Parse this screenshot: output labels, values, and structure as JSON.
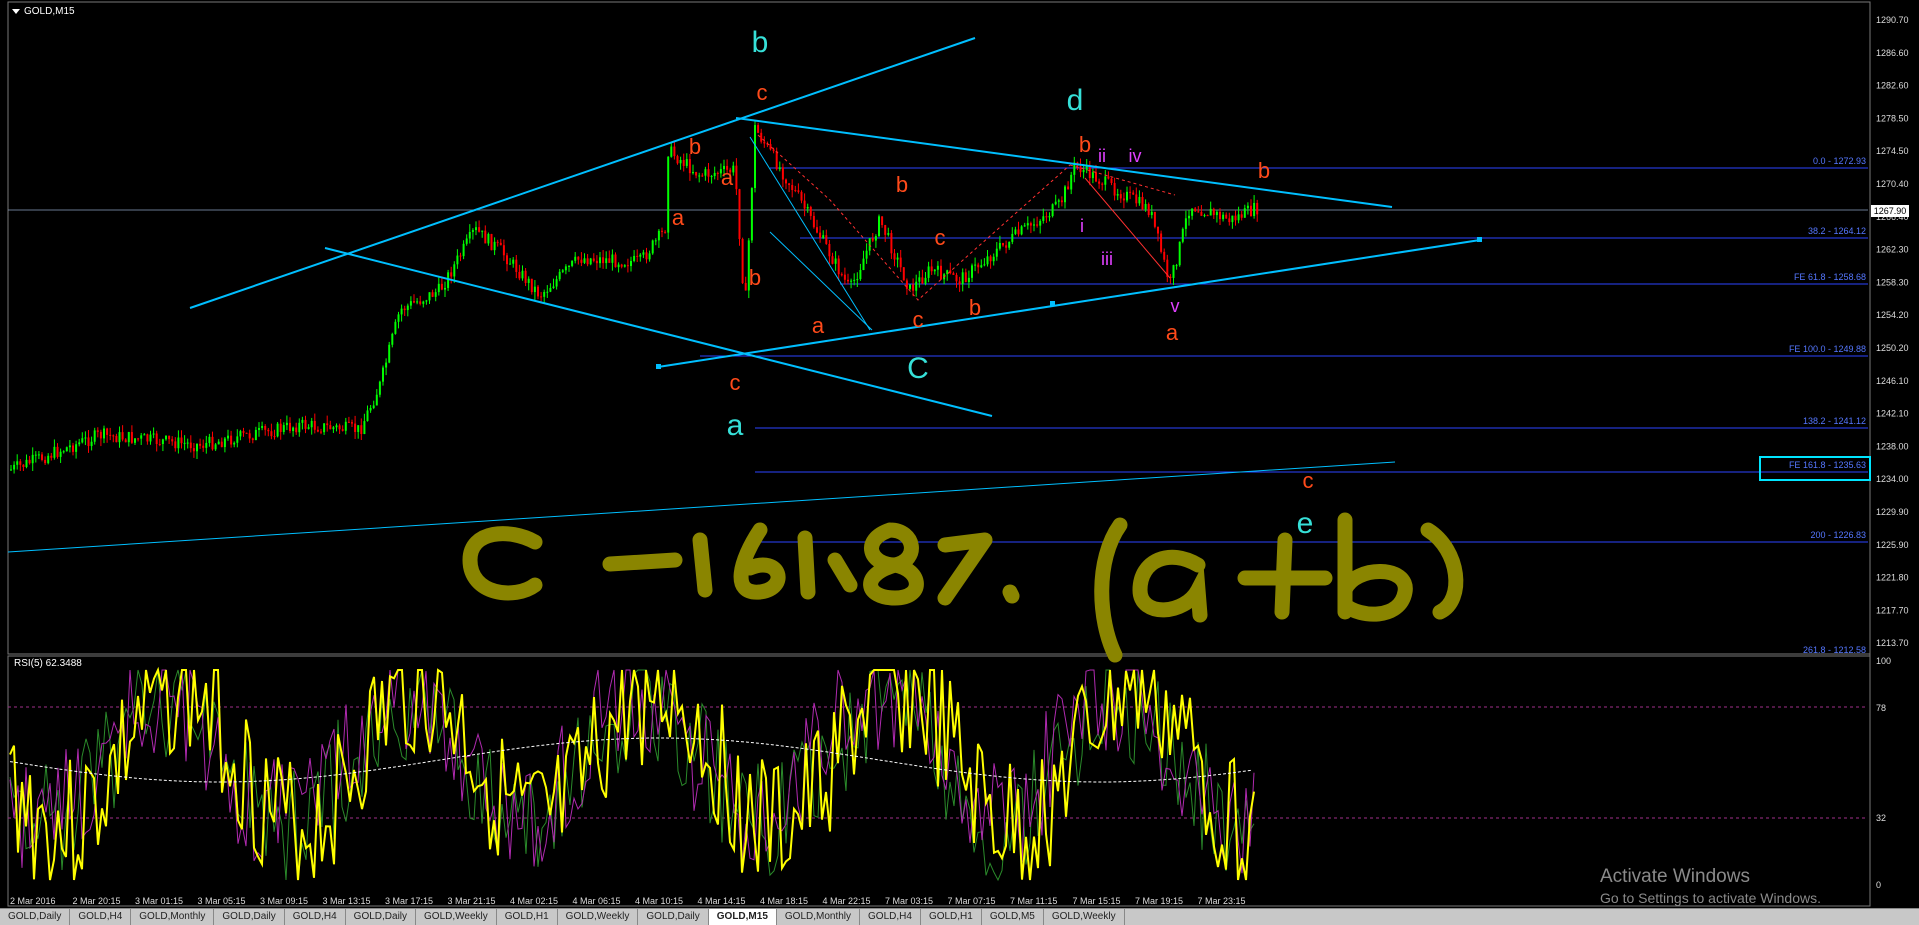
{
  "window": {
    "title": "GOLD,M15"
  },
  "price_axis": [
    "1290.70",
    "1286.60",
    "1282.60",
    "1278.50",
    "1274.50",
    "1270.40",
    "1266.40",
    "1262.30",
    "1258.30",
    "1254.20",
    "1250.20",
    "1246.10",
    "1242.10",
    "1238.00",
    "1234.00",
    "1229.90",
    "1225.90",
    "1221.80",
    "1217.70",
    "1213.70"
  ],
  "current_price": "1267.90",
  "fib_levels": [
    "0.0 - 1272.93",
    "38.2 - 1264.12",
    "FE 61.8 - 1258.68",
    "FE 100.0 - 1249.88",
    "138.2 - 1241.12",
    "FE 161.8 - 1235.63",
    "200 - 1226.83",
    "261.8 - 1212.58"
  ],
  "wave_labels": {
    "cyan": [
      "b",
      "d",
      "C",
      "a",
      "e"
    ],
    "red": [
      "c",
      "b",
      "a",
      "a",
      "b",
      "c",
      "b",
      "a",
      "b",
      "c",
      "b",
      "c",
      "a",
      "b",
      "c"
    ],
    "magenta": [
      "ii",
      "iv",
      "i",
      "iii",
      "v"
    ]
  },
  "annotation": "c = 161.8% (a+b)",
  "rsi": {
    "label": "RSI(5) 62.3488",
    "levels": [
      "100",
      "78",
      "32",
      "0"
    ]
  },
  "time_axis": [
    "2 Mar 2016",
    "2 Mar 20:15",
    "3 Mar 01:15",
    "3 Mar 05:15",
    "3 Mar 09:15",
    "3 Mar 13:15",
    "3 Mar 17:15",
    "3 Mar 21:15",
    "4 Mar 02:15",
    "4 Mar 06:15",
    "4 Mar 10:15",
    "4 Mar 14:15",
    "4 Mar 18:15",
    "4 Mar 22:15",
    "7 Mar 03:15",
    "7 Mar 07:15",
    "7 Mar 11:15",
    "7 Mar 15:15",
    "7 Mar 19:15",
    "7 Mar 23:15"
  ],
  "tabs": [
    "GOLD,Daily",
    "GOLD,H4",
    "GOLD,Monthly",
    "GOLD,Daily",
    "GOLD,H4",
    "GOLD,Daily",
    "GOLD,Weekly",
    "GOLD,H1",
    "GOLD,Weekly",
    "GOLD,Daily",
    "GOLD,M15",
    "GOLD,Monthly",
    "GOLD,H4",
    "GOLD,H1",
    "GOLD,M5",
    "GOLD,Weekly"
  ],
  "active_tab_index": 10,
  "watermark": {
    "line1": "Activate Windows",
    "line2": "Go to Settings to activate Windows."
  },
  "colors": {
    "bg": "#000000",
    "bull": "#00ff00",
    "bear": "#ff0000",
    "trendline": "#00bfff",
    "fib": "#3a5bff",
    "wave_cyan": "#36e0d8",
    "wave_red": "#ff4a1a",
    "wave_magenta": "#e040ff",
    "rsi": "#ffff00",
    "handwriting": "#8a8500"
  }
}
